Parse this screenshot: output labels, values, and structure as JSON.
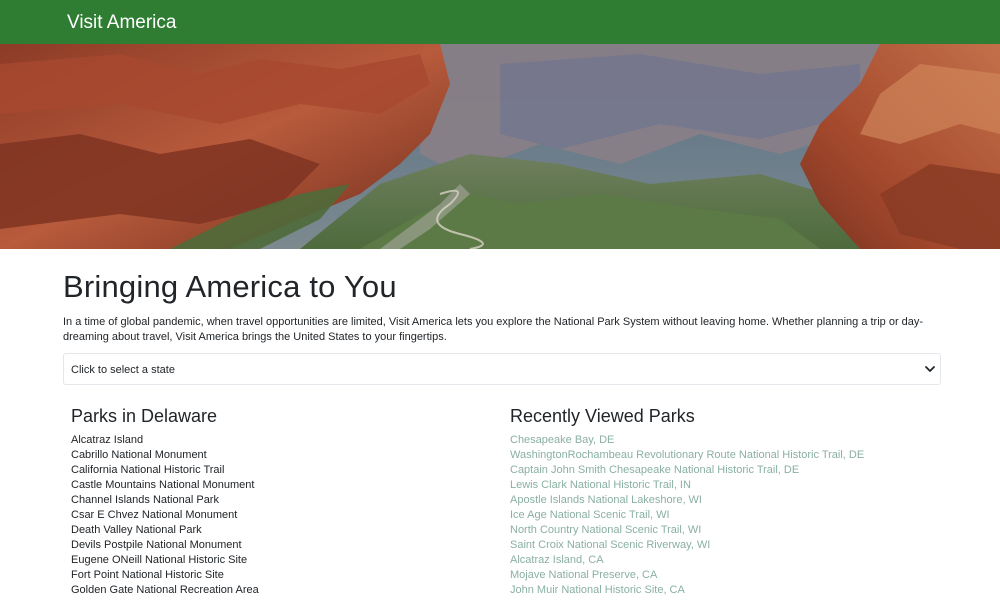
{
  "navbar": {
    "brand": "Visit America"
  },
  "hero": {
    "alt": "canyon-landscape"
  },
  "main": {
    "title": "Bringing America to You",
    "intro": "In a time of global pandemic, when travel opportunities are limited, Visit America lets you explore the National Park System without leaving home. Whether planning a trip or day-dreaming about travel, Visit America brings the United States to your fingertips.",
    "state_select": {
      "value": "Click to select a state"
    }
  },
  "parks": {
    "heading": "Parks in Delaware",
    "items": [
      "Alcatraz Island",
      "Cabrillo National Monument",
      "California National Historic Trail",
      "Castle Mountains National Monument",
      "Channel Islands National Park",
      "Csar E Chvez National Monument",
      "Death Valley National Park",
      "Devils Postpile National Monument",
      "Eugene ONeill National Historic Site",
      "Fort Point National Historic Site",
      "Golden Gate National Recreation Area"
    ]
  },
  "recent": {
    "heading": "Recently Viewed Parks",
    "items": [
      "Chesapeake Bay, DE",
      "WashingtonRochambeau Revolutionary Route National Historic Trail, DE",
      "Captain John Smith Chesapeake National Historic Trail, DE",
      "Lewis Clark National Historic Trail, IN",
      "Apostle Islands National Lakeshore, WI",
      "Ice Age National Scenic Trail, WI",
      "North Country National Scenic Trail, WI",
      "Saint Croix National Scenic Riverway, WI",
      "Alcatraz Island, CA",
      "Mojave National Preserve, CA",
      "John Muir National Historic Site, CA"
    ]
  },
  "colors": {
    "navbar": "#2e7d32",
    "recent_link": "#8ab0a1"
  }
}
